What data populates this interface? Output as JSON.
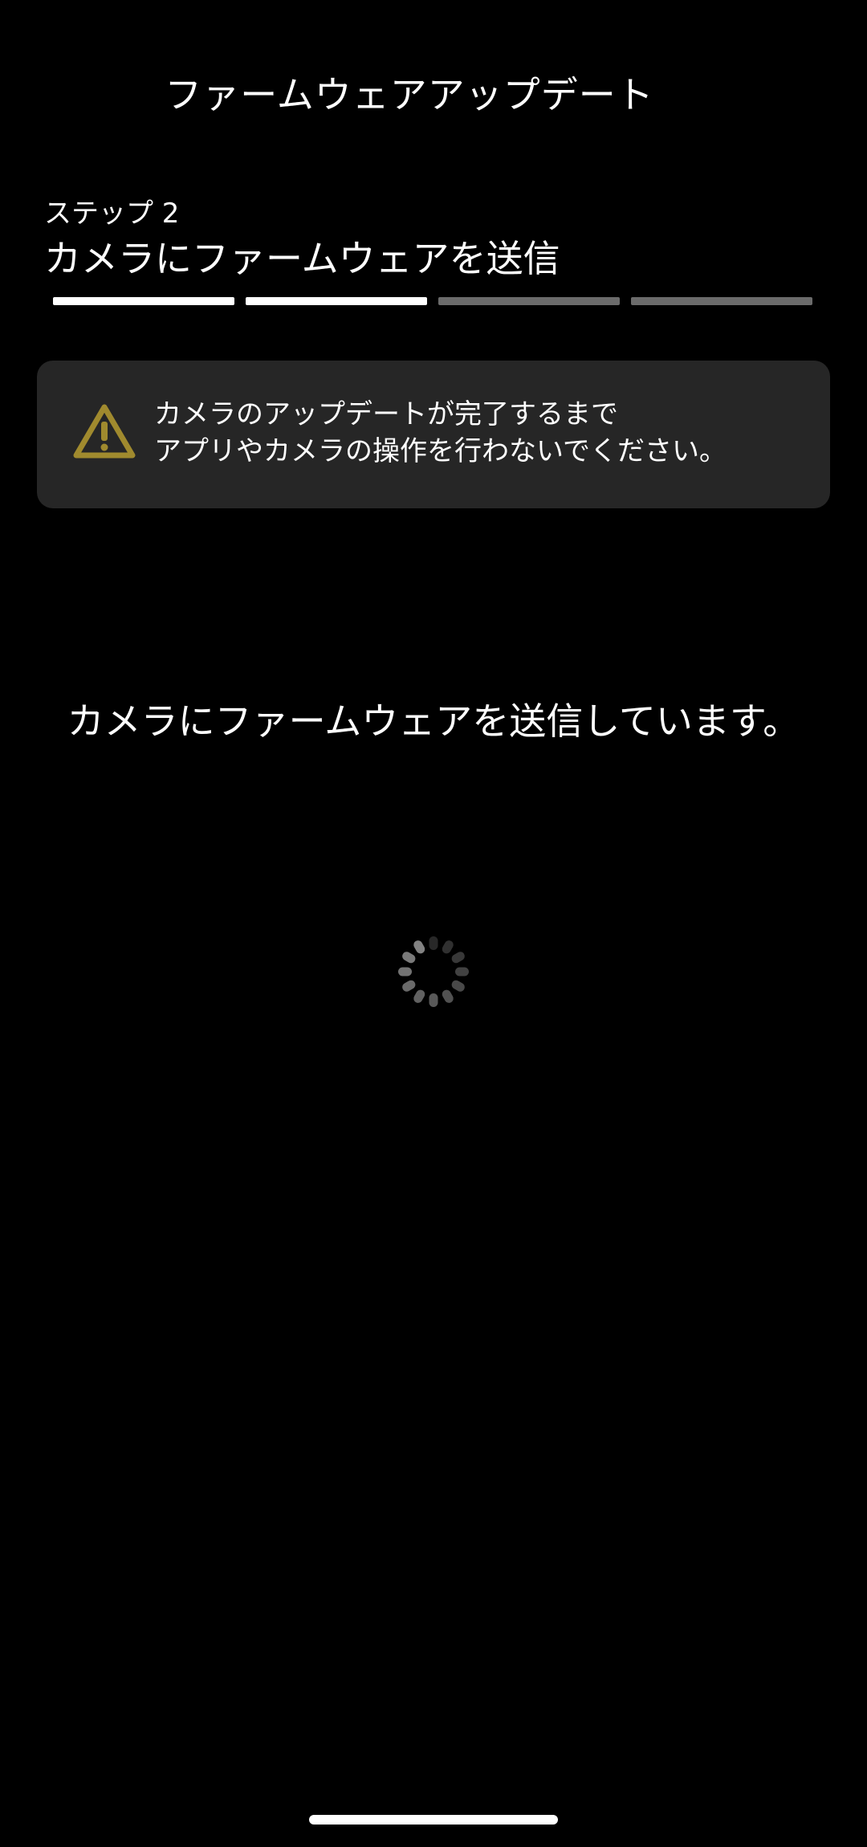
{
  "header": {
    "title": "ファームウェアアップデート"
  },
  "step": {
    "label": "ステップ 2",
    "title": "カメラにファームウェアを送信",
    "total_steps": 4,
    "completed_steps": 2
  },
  "warning": {
    "icon": "warning-triangle-icon",
    "line1": "カメラのアップデートが完了するまで",
    "line2": "アプリやカメラの操作を行わないでください。"
  },
  "status": {
    "message": "カメラにファームウェアを送信しています。",
    "spinner_icon": "loading-spinner-icon"
  },
  "colors": {
    "background": "#000000",
    "text": "#ffffff",
    "progress_active": "#ffffff",
    "progress_inactive": "#6b6b6b",
    "card_background": "#262626",
    "warning_icon": "#a08a2e"
  }
}
